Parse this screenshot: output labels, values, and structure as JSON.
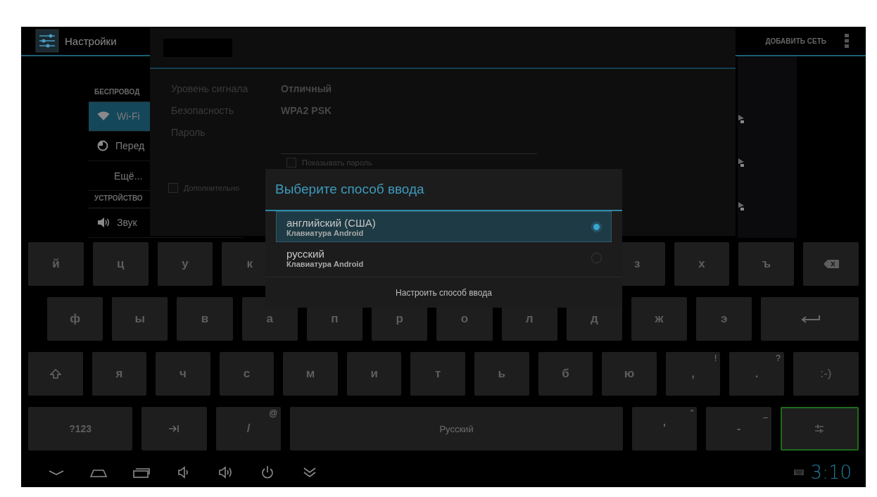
{
  "action_bar": {
    "title": "Настройки",
    "action": "ДОБАВИТЬ СЕТЬ"
  },
  "sidebar": [
    {
      "kind": "header",
      "label": "БЕСПРОВОД"
    },
    {
      "kind": "wifi",
      "label": "Wi-Fi",
      "selected": true
    },
    {
      "kind": "usage",
      "label": "Перед",
      "selected": false
    },
    {
      "kind": "plain",
      "label": "Ещё...",
      "selected": false
    },
    {
      "kind": "header",
      "label": "УСТРОЙСТВО"
    },
    {
      "kind": "sound",
      "label": "Звук",
      "selected": false
    }
  ],
  "wifi_dialog": {
    "rows": [
      {
        "label": "Уровень сигнала",
        "value": "Отличный"
      },
      {
        "label": "Безопасность",
        "value": "WPA2 PSK"
      }
    ],
    "password_label": "Пароль",
    "show_password": {
      "label": "Показывать пароль",
      "checked": false
    },
    "advanced": {
      "label": "Дополнительно",
      "checked": false
    }
  },
  "ime_dialog": {
    "title": "Выберите способ ввода",
    "options": [
      {
        "name": "английский (США)",
        "subtitle": "Клавиатура Android",
        "selected": true
      },
      {
        "name": "русский",
        "subtitle": "Клавиатура Android",
        "selected": false
      }
    ],
    "footer": "Настроить способ ввода"
  },
  "keyboard": {
    "rows": [
      {
        "left": [
          {
            "label": "й"
          },
          {
            "label": "ц"
          },
          {
            "label": "у"
          },
          {
            "label": "к"
          }
        ],
        "right": [
          {
            "label": "з"
          },
          {
            "label": "х"
          },
          {
            "label": "ъ"
          },
          {
            "kind": "backspace"
          }
        ]
      },
      {
        "keys": [
          {
            "label": "ф"
          },
          {
            "label": "ы"
          },
          {
            "label": "в"
          },
          {
            "label": "а"
          },
          {
            "label": "п"
          },
          {
            "label": "р"
          },
          {
            "label": "о"
          },
          {
            "label": "л"
          },
          {
            "label": "д"
          },
          {
            "label": "ж"
          },
          {
            "label": "э"
          },
          {
            "kind": "enter"
          }
        ]
      },
      {
        "keys": [
          {
            "kind": "shift"
          },
          {
            "label": "я"
          },
          {
            "label": "ч"
          },
          {
            "label": "с"
          },
          {
            "label": "м"
          },
          {
            "label": "и"
          },
          {
            "label": "т"
          },
          {
            "label": "ь"
          },
          {
            "label": "б"
          },
          {
            "label": "ю"
          },
          {
            "label": ",",
            "hint": "!"
          },
          {
            "label": ".",
            "hint": "?"
          },
          {
            "label": ":-)",
            "kind": "smiley"
          }
        ]
      },
      {
        "keys": [
          {
            "label": "?123",
            "kind": "mode"
          },
          {
            "kind": "tab"
          },
          {
            "label": "/",
            "hint": "@"
          },
          {
            "kind": "space",
            "label": "Русский"
          },
          {
            "label": "'",
            "hint": "\""
          },
          {
            "label": "-",
            "hint": "_"
          },
          {
            "kind": "settings",
            "focused": true
          }
        ]
      }
    ]
  },
  "status_bar": {
    "time": "3:10"
  }
}
